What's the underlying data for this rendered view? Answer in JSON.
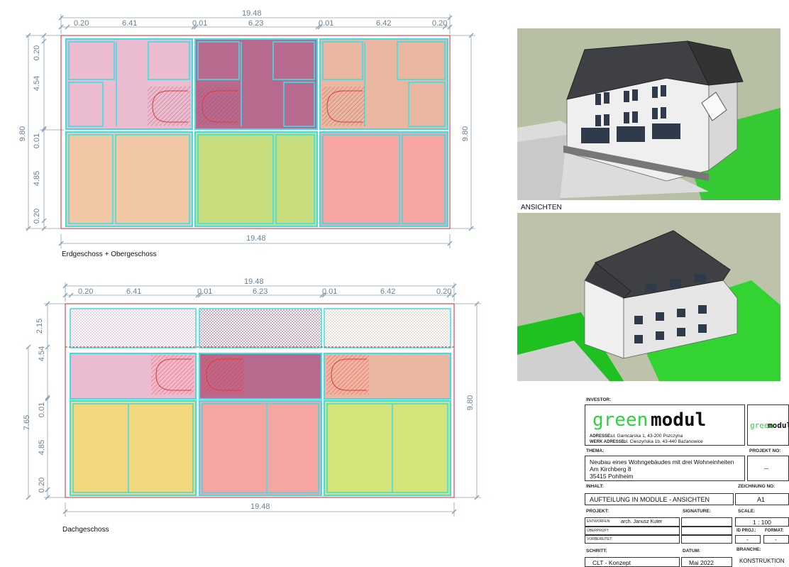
{
  "plans": {
    "ground": {
      "caption": "Erdgeschoss  +  Obergeschoss",
      "top_total": "19.48",
      "bottom_total": "19.48",
      "top_dims": [
        "0.20",
        "6.41",
        "0.01",
        "6.23",
        "0.01",
        "6.42",
        "0.20"
      ],
      "left_dims": [
        "0.20",
        "4.54",
        "0.01",
        "4.85",
        "0.20"
      ],
      "left_total": "9.80",
      "right_total": "9.80"
    },
    "roof": {
      "caption": "Dachgeschoss",
      "top_total": "19.48",
      "bottom_total": "19.48",
      "top_dims": [
        "0.20",
        "6.41",
        "0.01",
        "6.23",
        "0.01",
        "6.42",
        "0.20"
      ],
      "left_dims": [
        "2.15",
        "4.54",
        "0.01",
        "4.85",
        "0.20"
      ],
      "left_outer": "7.65",
      "right_total": "9.80"
    }
  },
  "views": {
    "caption": "ANSICHTEN"
  },
  "colors": {
    "cyan": "#39e0e8",
    "red_outline": "#d8262c",
    "dim_text": "#6a7e93",
    "light_pink": "#ebbbd0",
    "plum": "#b86a8e",
    "salmon": "#e9b7a2",
    "peach": "#f2c7a3",
    "lime": "#c8de7e",
    "coral": "#f6a5a3",
    "yellow": "#f2d77e",
    "pale_lime": "#d5e47a",
    "logo_green": "#2fd13c"
  },
  "titleblock": {
    "investor_label": "INVESTOR:",
    "logo_word1": "green",
    "logo_word2": "modul",
    "address_label": "ADRESSE:",
    "address": "ul. Garncarska 1, 43-200 Pszczyna",
    "werk_label": "WERK ADRESSE:",
    "werk": "ul. Cieszyńska 1b,  43-440 Bażanowice",
    "thema_label": "THEMA:",
    "projekt_nr_label": "PROJEKT NO:",
    "thema_line1": "Neubau eines Wohngebäudes mit drei Wohneinheiten",
    "thema_line2": "Am Kirchberg 8",
    "thema_line3": "35415 Pohlheim",
    "projekt_nr": "--",
    "inhalt_label": "INHALT:",
    "zeichnung_label": "ZEICHNUNG NO:",
    "inhalt": "AUFTEILUNG IN MODULE - ANSICHTEN",
    "zeichnung": "A1",
    "projekt_label": "PROJEKT:",
    "signature_label": "SIGNATURE:",
    "scale_label": "SCALE:",
    "entworfen_label": "ENTWORFEN:",
    "entworfen": "arch. Janusz Kuter",
    "scale": "1 : 100",
    "uberpruft_label": "ÜBERPRÜFT:",
    "idproj_label": "ID PROJ.:",
    "format_label": "FORMAT:",
    "vorbereitet_label": "VORBEREITET:",
    "idproj": "-",
    "format": "-",
    "schritt_label": "SCHRITT:",
    "datum_label": "DATUM:",
    "branche_label": "BRANCHE:",
    "schritt": "CLT - Konzept",
    "datum": "Mai 2022",
    "branche": "KONSTRUKTION"
  }
}
